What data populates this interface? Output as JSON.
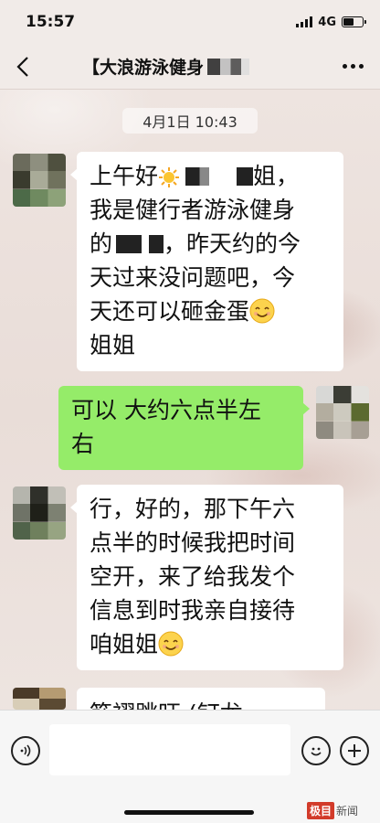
{
  "status_bar": {
    "time": "15:57",
    "network": "4G"
  },
  "header": {
    "title": "【大浪游泳健身",
    "back_icon": "chevron-left-icon",
    "more_icon": "more-dots-icon"
  },
  "chat": {
    "timestamp": "4月1日 10:43",
    "messages": [
      {
        "side": "in",
        "segments": [
          "上午好",
          "姐，",
          "我是健行者游泳健身",
          "的",
          "，昨天约的今",
          "天过来没问题吧，今",
          "天还可以砸金蛋",
          "姐姐"
        ]
      },
      {
        "side": "out",
        "lines": [
          "可以 大约六点半左",
          "右"
        ]
      },
      {
        "side": "in",
        "lines": [
          "行，好的，那下午六",
          "点半的时候我把时间",
          "空开，来了给我发个",
          "信息到时我亲自接待",
          "咱姐姐"
        ]
      },
      {
        "side": "in",
        "lines": [
          "筋褶跳旺 (钉龙"
        ]
      }
    ]
  },
  "input_bar": {
    "voice_icon": "voice-icon",
    "emoji_icon": "emoji-icon",
    "plus_icon": "plus-icon",
    "value": ""
  },
  "watermark": {
    "brand": "极目",
    "suffix": "新闻"
  },
  "colors": {
    "outgoing_bubble": "#95ec69",
    "incoming_bubble": "#ffffff",
    "background": "#ece3df"
  }
}
